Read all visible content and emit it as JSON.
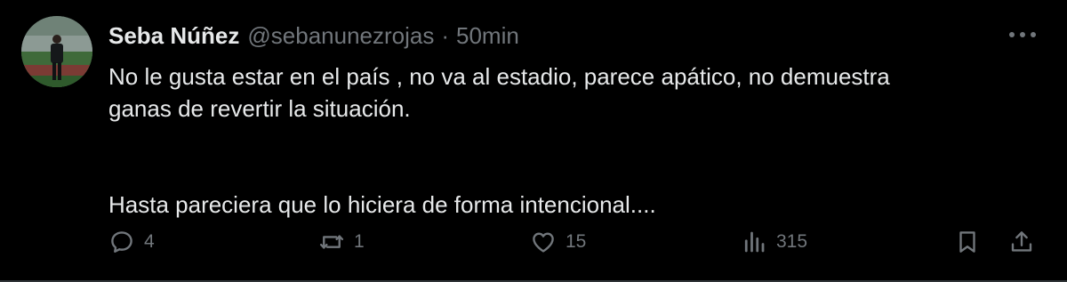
{
  "tweet": {
    "display_name": "Seba Núñez",
    "handle": "@sebanunezrojas",
    "separator": "·",
    "timestamp": "50min",
    "text_line1": "No le gusta estar en el país , no va al estadio, parece apático, no demuestra",
    "text_line2": "ganas de revertir la situación.",
    "text_line3": "Hasta pareciera que lo hiciera de forma intencional...."
  },
  "actions": {
    "reply_count": "4",
    "repost_count": "1",
    "like_count": "15",
    "views_count": "315"
  },
  "icons": {
    "reply": "reply-icon",
    "repost": "repost-icon",
    "like": "heart-icon",
    "views": "views-icon",
    "bookmark": "bookmark-icon",
    "share": "share-icon",
    "more": "more-icon"
  },
  "colors": {
    "background": "#000000",
    "primary_text": "#e7e9ea",
    "secondary_text": "#71767b"
  }
}
